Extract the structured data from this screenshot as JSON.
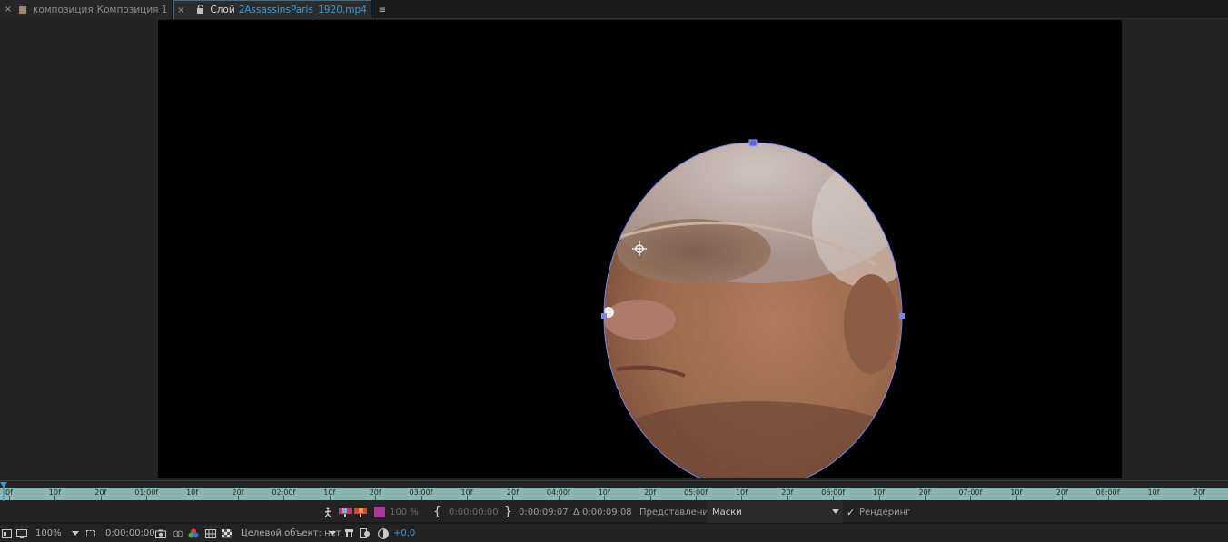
{
  "tabs": [
    {
      "close": "×",
      "swatch_color": "#9b8a6e",
      "label": "композиция",
      "name": "Композиция 1",
      "active": false
    },
    {
      "close": "×",
      "swatch_color": "#a9d3d4",
      "label": "Слой",
      "name": "2AssassinsParis_1920.mp4",
      "menu": "≡",
      "active": true
    }
  ],
  "ruler": {
    "ticks": [
      "0f",
      "10f",
      "20f",
      "01:00f",
      "10f",
      "20f",
      "02:00f",
      "10f",
      "20f",
      "03:00f",
      "10f",
      "20f",
      "04:00f",
      "10f",
      "20f",
      "05:00f",
      "10f",
      "20f",
      "06:00f",
      "10f",
      "20f",
      "07:00f",
      "10f",
      "20f",
      "08:00f",
      "10f",
      "20f"
    ]
  },
  "layer_controls": {
    "opacity": "100 %",
    "in_point": "0:00:00:00",
    "out_point": "0:00:09:07",
    "duration": "Δ 0:00:09:08",
    "view_label": "Представление:",
    "view_value": "Маски",
    "render_check": "✓",
    "render_label": "Рендеринг"
  },
  "status_bar": {
    "zoom": "100%",
    "timecode": "0:00:00:00",
    "target_label": "Целевой объект: нет",
    "exposure": "+0,0"
  },
  "colors": {
    "accent": "#3a9ad9",
    "mask_path": "#7b84e8",
    "ruler": "#8ab6ad",
    "panel_bg": "#232323"
  },
  "icons": [
    "close-icon",
    "lock-icon",
    "panel-menu-icon",
    "snapshot-icon",
    "color-channel-icon",
    "grid-icon",
    "transparency-icon",
    "anchor-point-icon",
    "brush-icon",
    "eraser-icon",
    "playhead-icon"
  ]
}
